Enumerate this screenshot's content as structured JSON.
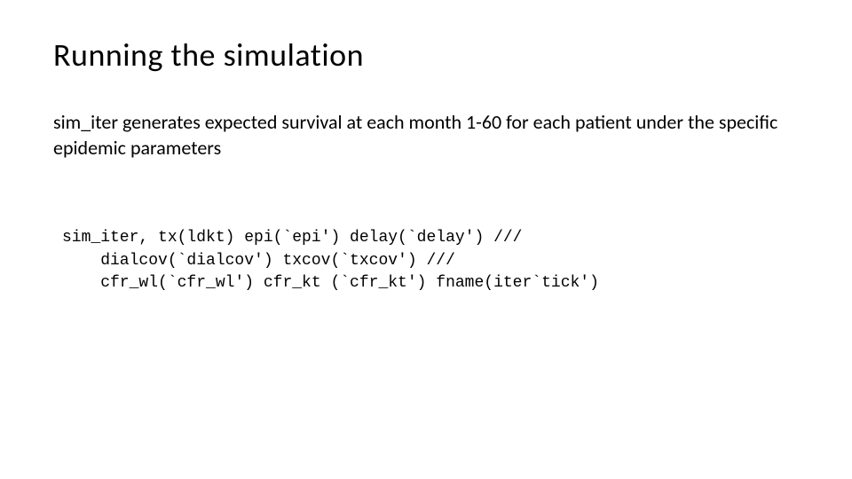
{
  "slide": {
    "title": "Running the simulation",
    "body": "sim_iter generates expected survival at each month 1-60 for each patient under the specific epidemic parameters",
    "code": {
      "line1": "sim_iter, tx(ldkt) epi(`epi') delay(`delay') ///",
      "line2": "    dialcov(`dialcov') txcov(`txcov') ///",
      "line3": "    cfr_wl(`cfr_wl') cfr_kt (`cfr_kt') fname(iter`tick')"
    }
  }
}
